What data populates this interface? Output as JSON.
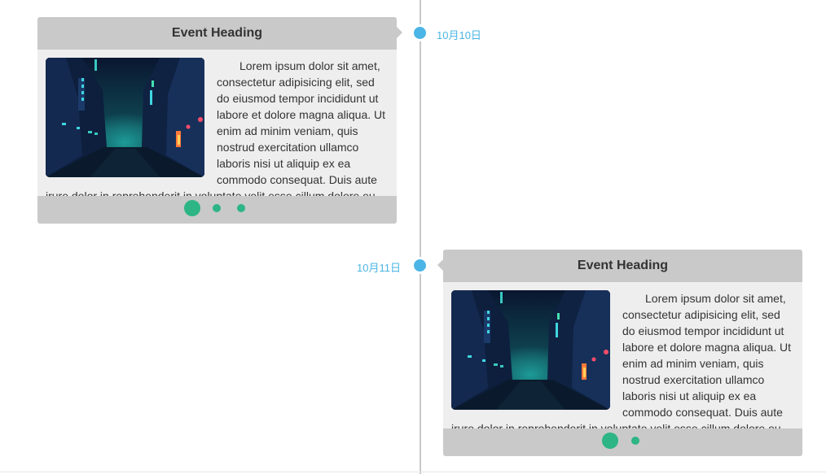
{
  "colors": {
    "accent": "#4bb5e5",
    "dot": "#2db585",
    "header_bg": "#c9c9c9",
    "body_bg": "#eeeeee",
    "line": "#c8c8c8"
  },
  "events": [
    {
      "date": "10月10日",
      "heading": "Event Heading",
      "image_icon": "night-city-street-image",
      "text": "Lorem ipsum dolor sit amet, consectetur adipisicing elit, sed do eiusmod tempor incididunt ut labore et dolore magna aliqua. Ut enim ad minim veniam, quis nostrud exercitation ullamco laboris nisi ut aliquip ex ea commodo consequat. Duis aute irure dolor in reprehenderit in voluptate velit esse cillum dolore eu",
      "pagination": {
        "total": 3,
        "active": 1
      }
    },
    {
      "date": "10月11日",
      "heading": "Event Heading",
      "image_icon": "night-city-street-image",
      "text": "Lorem ipsum dolor sit amet, consectetur adipisicing elit, sed do eiusmod tempor incididunt ut labore et dolore magna aliqua. Ut enim ad minim veniam, quis nostrud exercitation ullamco laboris nisi ut aliquip ex ea commodo consequat. Duis aute irure dolor in reprehenderit in voluptate velit esse cillum dolore eu",
      "pagination": {
        "total": 2,
        "active": 1
      }
    }
  ]
}
